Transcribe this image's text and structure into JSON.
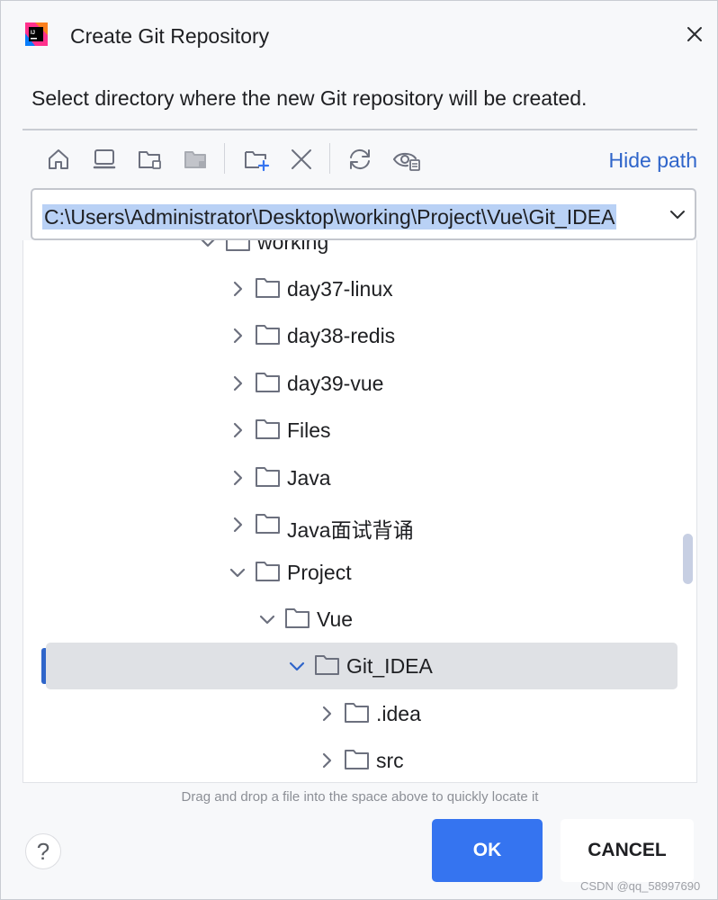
{
  "dialog": {
    "title": "Create Git Repository",
    "description": "Select directory where the new Git repository will be created.",
    "hide_path_label": "Hide path",
    "path_value": "C:\\Users\\Administrator\\Desktop\\working\\Project\\Vue\\Git_IDEA",
    "hint": "Drag and drop a file into the space above to quickly locate it",
    "help_label": "?",
    "ok_label": "OK",
    "cancel_label": "CANCEL",
    "watermark": "CSDN @qq_58997690"
  },
  "toolbar": {
    "icons": [
      "home-icon",
      "desktop-icon",
      "project-folder-icon",
      "module-folder-icon",
      "new-folder-icon",
      "delete-icon",
      "refresh-icon",
      "show-hidden-icon"
    ]
  },
  "tree": {
    "items": [
      {
        "label": "working",
        "state": "expanded"
      },
      {
        "label": "day37-linux",
        "state": "collapsed"
      },
      {
        "label": "day38-redis",
        "state": "collapsed"
      },
      {
        "label": "day39-vue",
        "state": "collapsed"
      },
      {
        "label": "Files",
        "state": "collapsed"
      },
      {
        "label": "Java",
        "state": "collapsed"
      },
      {
        "label": "Java面试背诵",
        "state": "collapsed"
      },
      {
        "label": "Project",
        "state": "expanded"
      },
      {
        "label": "Vue",
        "state": "expanded"
      },
      {
        "label": "Git_IDEA",
        "state": "expanded",
        "selected": true
      },
      {
        "label": ".idea",
        "state": "collapsed"
      },
      {
        "label": "src",
        "state": "collapsed"
      }
    ]
  },
  "colors": {
    "accent": "#3574f0",
    "link": "#2f65ca",
    "selection": "#dfe1e5",
    "path_highlight": "#b9d1f5"
  }
}
